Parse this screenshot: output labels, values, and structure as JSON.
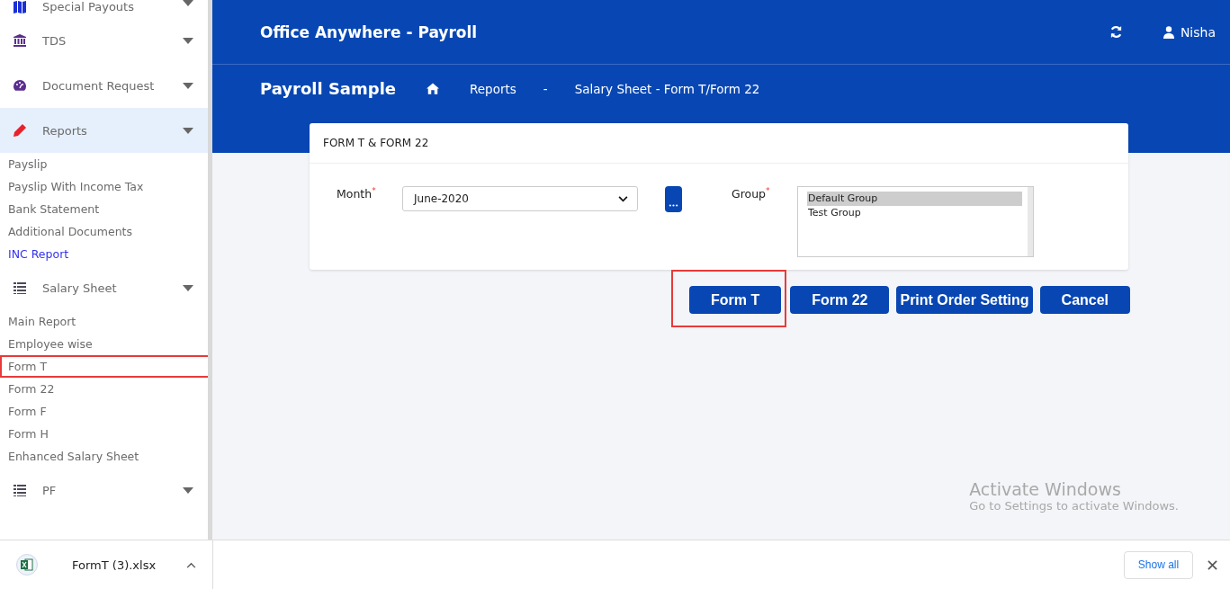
{
  "sidebar": {
    "items": [
      {
        "kind": "section",
        "label": "Special Payouts",
        "selected": false
      },
      {
        "kind": "section",
        "label": "TDS",
        "selected": false
      },
      {
        "kind": "section",
        "label": "Document Request",
        "selected": false
      },
      {
        "kind": "section",
        "label": "Reports",
        "selected": true
      },
      {
        "kind": "link",
        "label": "Payslip",
        "selected": false,
        "highlighted": false
      },
      {
        "kind": "link",
        "label": "Payslip With Income Tax",
        "selected": false,
        "highlighted": false
      },
      {
        "kind": "link",
        "label": "Bank Statement",
        "selected": false,
        "highlighted": false
      },
      {
        "kind": "link",
        "label": "Additional Documents",
        "selected": false,
        "highlighted": false
      },
      {
        "kind": "link",
        "label": "INC Report",
        "selected": true,
        "highlighted": false
      },
      {
        "kind": "section",
        "label": "Salary Sheet",
        "selected": false
      },
      {
        "kind": "link",
        "label": "Main Report",
        "selected": false,
        "highlighted": false
      },
      {
        "kind": "link",
        "label": "Employee wise",
        "selected": false,
        "highlighted": false
      },
      {
        "kind": "link",
        "label": "Form T",
        "selected": false,
        "highlighted": true
      },
      {
        "kind": "link",
        "label": "Form 22",
        "selected": false,
        "highlighted": false
      },
      {
        "kind": "link",
        "label": "Form F",
        "selected": false,
        "highlighted": false
      },
      {
        "kind": "link",
        "label": "Form H",
        "selected": false,
        "highlighted": false
      },
      {
        "kind": "link",
        "label": "Enhanced Salary Sheet",
        "selected": false,
        "highlighted": false
      },
      {
        "kind": "section",
        "label": "PF",
        "selected": false
      }
    ]
  },
  "header": {
    "app_title": "Office Anywhere - Payroll",
    "user": "Nisha"
  },
  "breadcrumb": {
    "company": "Payroll Sample",
    "items": [
      "Reports",
      "-",
      "Salary Sheet - Form T/Form 22"
    ]
  },
  "card": {
    "title": "FORM T & FORM 22",
    "month": {
      "label": "Month",
      "required_mark": "*",
      "value": "June-2020"
    },
    "group": {
      "label": "Group",
      "required_mark": "*",
      "options": [
        {
          "label": "Default Group",
          "selected": true
        },
        {
          "label": "Test Group",
          "selected": false
        }
      ]
    }
  },
  "buttons": [
    {
      "label": "Form T",
      "highlighted": true
    },
    {
      "label": "Form 22",
      "highlighted": false
    },
    {
      "label": "Print Order Setting",
      "highlighted": false
    },
    {
      "label": "Cancel",
      "highlighted": false
    }
  ],
  "activation_notice": {
    "title": "Activate Windows",
    "text": "Go to Settings to activate Windows."
  },
  "download_bar": {
    "file": "FormT (3).xlsx",
    "show_all": "Show all"
  }
}
